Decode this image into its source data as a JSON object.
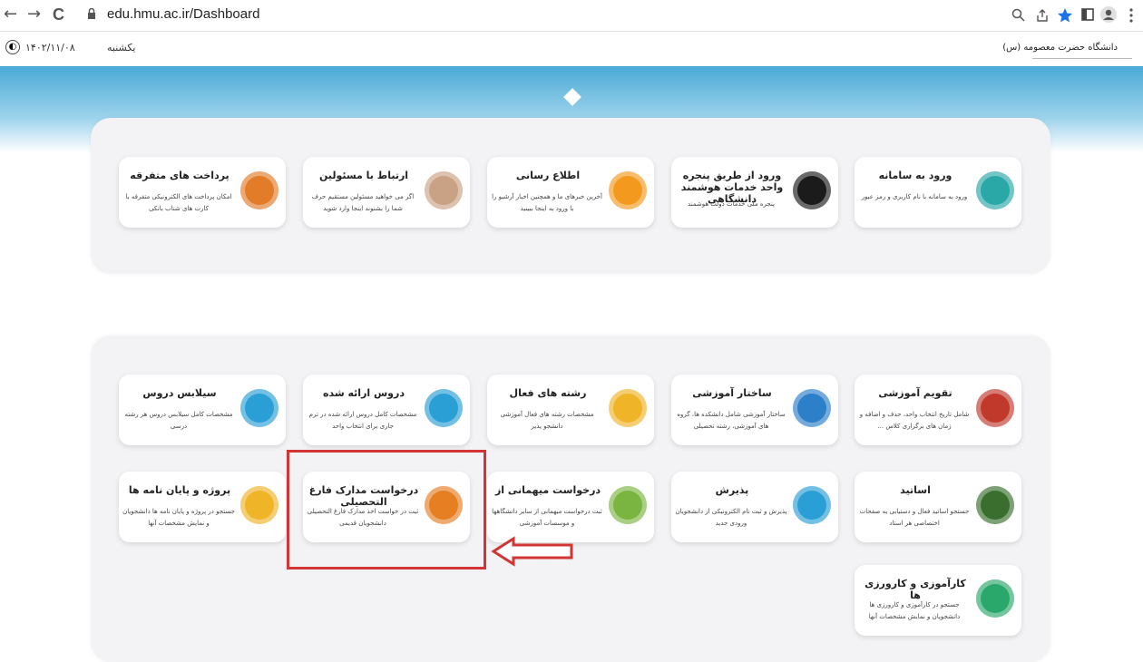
{
  "browser": {
    "url": "edu.hmu.ac.ir/Dashboard",
    "nav": [
      "←",
      "→",
      "C"
    ]
  },
  "topbar": {
    "date": "۱۴۰۲/۱۱/۰۸",
    "day": "یکشنبه",
    "university": "دانشگاه حضرت معصومه (س)"
  },
  "section1": [
    {
      "title": "ورود به سامانه",
      "desc": "ورود به سامانه با نام کاربری و رمز عبور",
      "icon": "house-icon",
      "color": "#2aa8a8"
    },
    {
      "title": "ورود از طریق پنجره واحد خدمات هوشمند دانشگاهی",
      "desc": "پنجره ملی خدمات دولت هوشمند",
      "icon": "emblem-icon",
      "color": "#1b1b1b"
    },
    {
      "title": "اطلاع رسانی",
      "desc": "آخرین خبرهای ما و همچنین اخبار آرشیو را با ورود به اینجا ببینید",
      "icon": "news-icon",
      "color": "#f39a1e"
    },
    {
      "title": "ارتباط با مسئولین",
      "desc": "اگر می خواهید مسئولین مستقیم حرف شما را بشنوند اینجا وارد شوید",
      "icon": "support-person-icon",
      "color": "#c9a184"
    },
    {
      "title": "پرداخت های متفرقه",
      "desc": "امکان پرداخت های الکترونیکی متفرقه با کارت های شتاب بانکی",
      "icon": "mobile-payment-icon",
      "color": "#e27c28"
    }
  ],
  "section2_row1": [
    {
      "title": "تقویم آموزشی",
      "desc": "شامل تاریخ انتخاب واحد، حذف و اضافه و زمان های برگزاری کلاس ...",
      "icon": "calendar-icon",
      "color": "#c0392b"
    },
    {
      "title": "ساختار آموزشی",
      "desc": "ساختار آموزشی شامل دانشکده ها، گروه های آموزشی، رشته تحصیلی",
      "icon": "org-chart-icon",
      "color": "#2c7fc9"
    },
    {
      "title": "رشته های فعال",
      "desc": "مشخصات رشته های فعال آموزشی دانشجو پذیر",
      "icon": "books-icon",
      "color": "#f0b429"
    },
    {
      "title": "دروس ارائه شده",
      "desc": "مشخصات کامل دروس ارائه شده در ترم جاری برای انتخاب واحد",
      "icon": "checklist-icon",
      "color": "#2a9fd6"
    },
    {
      "title": "سیلابس دروس",
      "desc": "مشخصات کامل سیلابس دروس هر رشته درسی",
      "icon": "syllabus-icon",
      "color": "#2a9fd6"
    }
  ],
  "section2_row2": [
    {
      "title": "اساتید",
      "desc": "جستجو اساتید فعال و دستیابی به صفحات اختصاصی هر استاد",
      "icon": "teacher-icon",
      "color": "#3a6e2f"
    },
    {
      "title": "پذیرش",
      "desc": "پذیرش و ثبت نام الکترونیکی از دانشجویان ورودی جدید",
      "icon": "form-pen-icon",
      "color": "#2a9fd6"
    },
    {
      "title": "درخواست میهمانی از",
      "desc": "ثبت درخواست میهمانی از سایر دانشگاهها و موسسات آموزشی",
      "icon": "guest-students-icon",
      "color": "#7ab541"
    },
    {
      "title": "درخواست مدارک فارغ التحصیلی",
      "desc": "ثبت در خواست اخذ مدارک فارغ التحصیلی دانشجویان قدیمی",
      "icon": "graduate-icon",
      "color": "#e67e22"
    },
    {
      "title": "پروژه و پایان نامه ها",
      "desc": "جستجو در پروژه و پایان نامه ها دانشجویان و نمایش مشخصات آنها",
      "icon": "graduate-cap-icon",
      "color": "#f0b429"
    }
  ],
  "section2_row3": [
    {
      "title": "کارآموزی و کارورزی ها",
      "desc": "جستجو در کارآموزی و کارورزی ها دانشجویان و نمایش مشخصات آنها",
      "icon": "presentation-icon",
      "color": "#2aa86b"
    }
  ]
}
